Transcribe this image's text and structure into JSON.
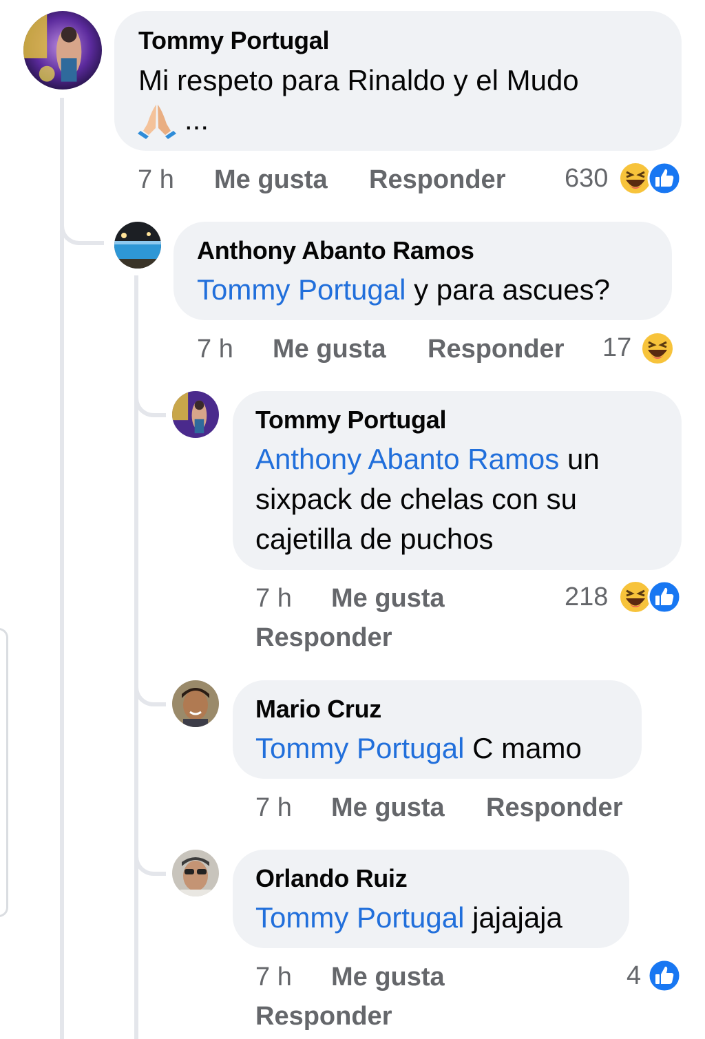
{
  "comments": [
    {
      "author": "Tommy Portugal",
      "text_line1": "Mi respeto para Rinaldo y el Mudo",
      "ellipsis": "...",
      "time": "7 h",
      "like_label": "Me gusta",
      "reply_label": "Responder",
      "reaction_count": "630",
      "reactions": [
        "haha-icon",
        "like-icon"
      ]
    },
    {
      "author": "Anthony Abanto Ramos",
      "mention": "Tommy Portugal",
      "text": " y para ascues?",
      "time": "7 h",
      "like_label": "Me gusta",
      "reply_label": "Responder",
      "reaction_count": "17",
      "reactions": [
        "haha-icon"
      ]
    },
    {
      "author": "Tommy Portugal",
      "mention": "Anthony Abanto Ramos",
      "text_line1": " un",
      "text_line2": "sixpack de chelas con su",
      "text_line3": "cajetilla de puchos",
      "time": "7 h",
      "like_label": "Me gusta",
      "reply_label": "Responder",
      "reaction_count": "218",
      "reactions": [
        "haha-icon",
        "like-icon"
      ]
    },
    {
      "author": "Mario Cruz",
      "mention": "Tommy Portugal",
      "text": " C mamo",
      "time": "7 h",
      "like_label": "Me gusta",
      "reply_label": "Responder"
    },
    {
      "author": "Orlando Ruiz",
      "mention": "Tommy Portugal",
      "text": " jajajaja",
      "time": "7 h",
      "like_label": "Me gusta",
      "reply_label": "Responder",
      "reaction_count": "4",
      "reactions": [
        "like-icon"
      ]
    }
  ],
  "colors": {
    "bubble": "#f0f2f5",
    "mention": "#216fdb",
    "meta": "#65676b",
    "like_blue": "#1877f2",
    "haha_yellow": "#f7c33b"
  }
}
